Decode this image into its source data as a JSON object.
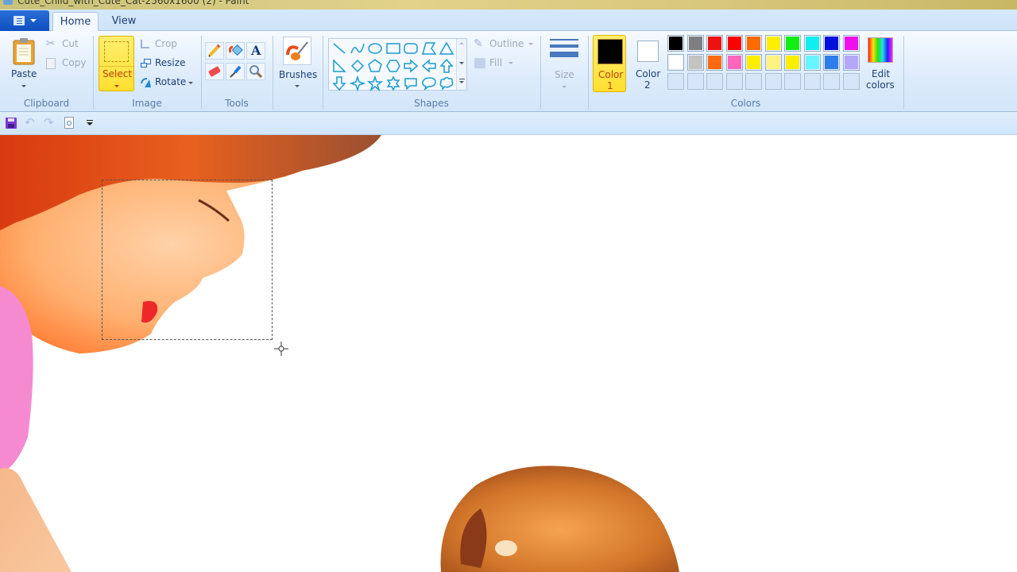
{
  "window": {
    "title": "Cute_Child_with_Cute_Cat-2560x1600 (2) - Paint"
  },
  "tabs": [
    {
      "label": "Home",
      "active": true
    },
    {
      "label": "View",
      "active": false
    }
  ],
  "app_menu": {
    "icon": "paint-menu-icon"
  },
  "ribbon": {
    "clipboard": {
      "group_label": "Clipboard",
      "paste": "Paste",
      "cut": "Cut",
      "copy": "Copy"
    },
    "image": {
      "group_label": "Image",
      "select": "Select",
      "crop": "Crop",
      "resize": "Resize",
      "rotate": "Rotate"
    },
    "tools": {
      "group_label": "Tools",
      "items": [
        "pencil",
        "fill-with-color",
        "text",
        "eraser",
        "color-picker",
        "magnifier"
      ]
    },
    "brushes": {
      "label": "Brushes"
    },
    "shapes": {
      "group_label": "Shapes",
      "items": [
        "line",
        "curve",
        "oval",
        "rectangle",
        "rounded-rectangle",
        "polygon",
        "triangle",
        "right-triangle",
        "diamond",
        "pentagon",
        "hexagon",
        "right-arrow",
        "left-arrow",
        "up-arrow",
        "down-arrow",
        "four-point-star",
        "five-point-star",
        "six-point-star",
        "rounded-callout",
        "oval-callout",
        "cloud-callout"
      ],
      "outline": "Outline",
      "fill": "Fill"
    },
    "size": {
      "label": "Size"
    },
    "colors": {
      "group_label": "Colors",
      "color1_label": "Color",
      "color1_num": "1",
      "color1_value": "#000000",
      "color2_label": "Color",
      "color2_num": "2",
      "color2_value": "#ffffff",
      "edit_colors_line1": "Edit",
      "edit_colors_line2": "colors",
      "palette_row1": [
        "#000000",
        "#7f7f7f",
        "#ee1111",
        "#ff0000",
        "#ff6a00",
        "#ffee00",
        "#11ee11",
        "#11eeee",
        "#0011dd",
        "#ee11ee"
      ],
      "palette_row2": [
        "#ffffff",
        "#c3c3c3",
        "#ff6a10",
        "#ff66bb",
        "#ffee00",
        "#fff280",
        "#ffee00",
        "#66f6ff",
        "#2e7de8",
        "#b4a6f8"
      ],
      "palette_row3_empty": 10
    }
  },
  "quick_access": [
    "save",
    "undo",
    "redo",
    "print-preview",
    "customize"
  ],
  "canvas": {
    "image_description": "Child leaning toward kitten on white background",
    "selection_active": true
  }
}
